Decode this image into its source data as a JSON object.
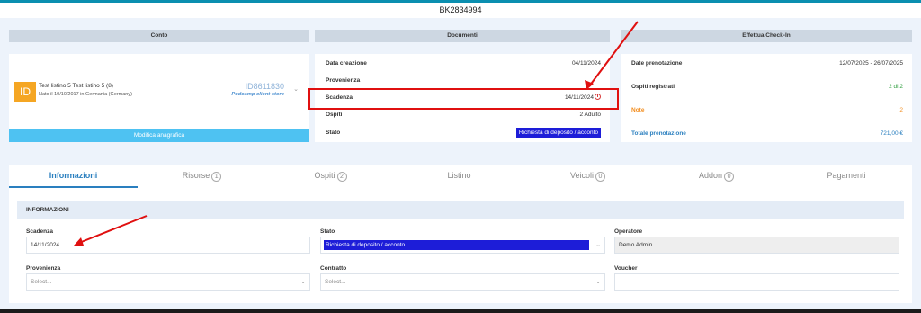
{
  "window": {
    "title": "BK2834994"
  },
  "sections": {
    "conto": "Conto",
    "documenti": "Documenti",
    "checkin": "Effettua Check-In"
  },
  "conto": {
    "icon_letters": "ID",
    "name": "Test listino 5 Test listino 5 (8)",
    "sub": "Nato il 10/10/2017 in Germania (Germany)",
    "id": "ID8611830",
    "store": "Podcamp client store",
    "button": "Modifica anagrafica"
  },
  "documenti": {
    "rows": [
      {
        "label": "Data creazione",
        "value": "04/11/2024"
      },
      {
        "label": "Provenienza",
        "value": ""
      },
      {
        "label": "Scadenza",
        "value": "14/11/2024"
      },
      {
        "label": "Ospiti",
        "value": "2 Adulto"
      },
      {
        "label": "Stato",
        "value": "Richiesta di deposito / acconto"
      }
    ]
  },
  "checkin": {
    "rows": [
      {
        "label": "Date prenotazione",
        "value": "12/07/2025 - 26/07/2025"
      },
      {
        "label": "Ospiti registrati",
        "value": "2 di 2"
      },
      {
        "label": "Note",
        "value": "2"
      },
      {
        "label": "Totale prenotazione",
        "value": "721,00 €"
      }
    ],
    "colors": {
      "registrati": "#2e9e3e",
      "note": "#f28c1c",
      "totale": "#2a7fbf"
    }
  },
  "tabs": [
    {
      "label": "Informazioni",
      "count": ""
    },
    {
      "label": "Risorse",
      "count": "1"
    },
    {
      "label": "Ospiti",
      "count": "2"
    },
    {
      "label": "Listino",
      "count": ""
    },
    {
      "label": "Veicoli",
      "count": "0"
    },
    {
      "label": "Addon",
      "count": "0"
    },
    {
      "label": "Pagamenti",
      "count": ""
    }
  ],
  "info": {
    "header": "INFORMAZIONI",
    "scadenza_label": "Scadenza",
    "scadenza_value": "14/11/2024",
    "stato_label": "Stato",
    "stato_value": "Richiesta di deposito / acconto",
    "operatore_label": "Operatore",
    "operatore_value": "Demo Admin",
    "provenienza_label": "Provenienza",
    "provenienza_placeholder": "Select...",
    "contratto_label": "Contratto",
    "contratto_placeholder": "Select...",
    "voucher_label": "Voucher",
    "voucher_value": ""
  },
  "colors": {
    "accent": "#2a7fbf",
    "badge": "#1d1dd8",
    "annotation": "#e01010",
    "button": "#4ec2f2"
  }
}
